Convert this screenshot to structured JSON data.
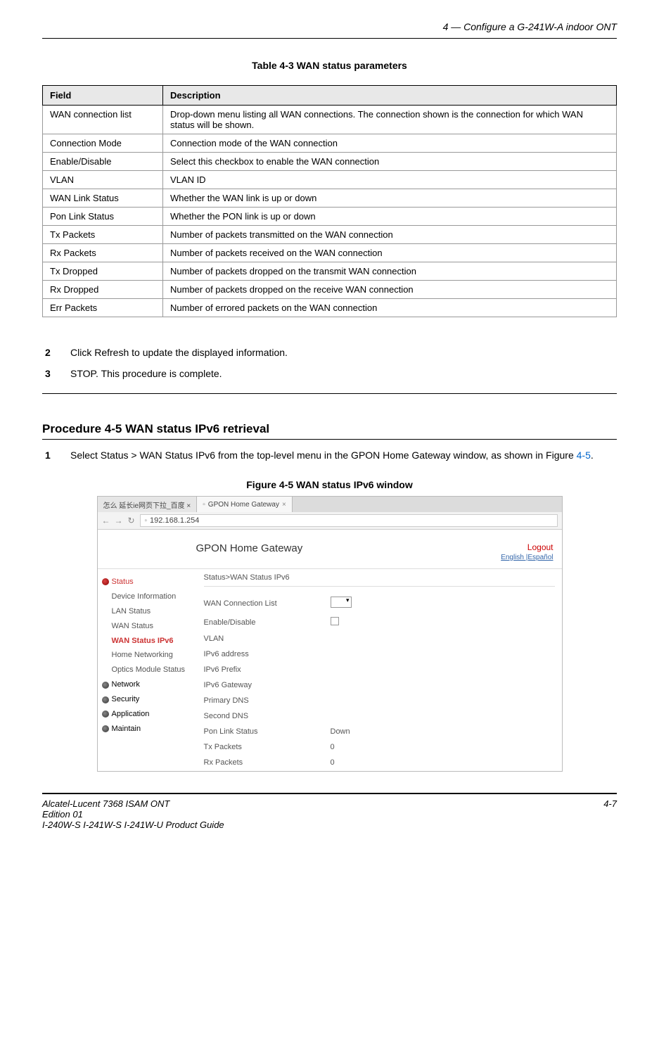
{
  "header": {
    "chapter_title": "4 —  Configure a G-241W-A indoor ONT"
  },
  "table_caption": "Table 4-3 WAN status parameters",
  "table": {
    "headers": [
      "Field",
      "Description"
    ],
    "rows": [
      {
        "field": "WAN connection list",
        "desc": "Drop-down menu listing all WAN connections. The connection shown is the connection for which WAN status will be shown."
      },
      {
        "field": "Connection Mode",
        "desc": "Connection mode of the WAN connection"
      },
      {
        "field": "Enable/Disable",
        "desc": "Select this checkbox to enable the WAN connection"
      },
      {
        "field": "VLAN",
        "desc": "VLAN ID"
      },
      {
        "field": "WAN Link Status",
        "desc": "Whether the WAN link is up or down"
      },
      {
        "field": "Pon Link Status",
        "desc": "Whether the PON link is up or down"
      },
      {
        "field": "Tx Packets",
        "desc": "Number of packets transmitted on the WAN connection"
      },
      {
        "field": "Rx Packets",
        "desc": "Number of packets received on the WAN connection"
      },
      {
        "field": "Tx Dropped",
        "desc": "Number of packets dropped on the transmit WAN connection"
      },
      {
        "field": "Rx Dropped",
        "desc": "Number of packets dropped on the receive WAN connection"
      },
      {
        "field": "Err Packets",
        "desc": "Number of errored packets on the WAN connection"
      }
    ]
  },
  "steps_a": [
    {
      "num": "2",
      "text": "Click Refresh to update the displayed information."
    },
    {
      "num": "3",
      "text": "STOP. This procedure is complete."
    }
  ],
  "procedure_title": "Procedure 4-5  WAN status IPv6 retrieval",
  "step_b": {
    "num": "1",
    "text_pre": "Select Status > WAN Status IPv6 from the top-level menu in the GPON Home Gateway window, as shown in Figure ",
    "fig_ref": "4-5",
    "text_post": "."
  },
  "figure_caption": "Figure 4-5  WAN status IPv6 window",
  "figure": {
    "tabs": [
      "怎么 延长ie网页下拉_百度 ×",
      "GPON Home Gateway"
    ],
    "url": "192.168.1.254",
    "gpon_header_title": "GPON Home Gateway",
    "logout": "Logout",
    "lang": "English |Español",
    "breadcrumb": "Status>WAN Status IPv6",
    "sidebar": {
      "status": "Status",
      "status_items": [
        "Device Information",
        "LAN Status",
        "WAN Status",
        "WAN Status IPv6",
        "Home Networking",
        "Optics Module Status"
      ],
      "network": "Network",
      "security": "Security",
      "application": "Application",
      "maintain": "Maintain"
    },
    "fields": [
      {
        "label": "WAN Connection List",
        "kind": "select",
        "value": ""
      },
      {
        "label": "Enable/Disable",
        "kind": "check",
        "value": ""
      },
      {
        "label": "VLAN",
        "kind": "text",
        "value": ""
      },
      {
        "label": "IPv6 address",
        "kind": "text",
        "value": ""
      },
      {
        "label": "IPv6 Prefix",
        "kind": "text",
        "value": ""
      },
      {
        "label": "IPv6 Gateway",
        "kind": "text",
        "value": ""
      },
      {
        "label": "Primary DNS",
        "kind": "text",
        "value": ""
      },
      {
        "label": "Second DNS",
        "kind": "text",
        "value": ""
      },
      {
        "label": "Pon Link Status",
        "kind": "text",
        "value": "Down"
      },
      {
        "label": "Tx Packets",
        "kind": "text",
        "value": "0"
      },
      {
        "label": "Rx Packets",
        "kind": "text",
        "value": "0"
      }
    ]
  },
  "footer": {
    "left_line1": "Alcatel-Lucent 7368 ISAM ONT",
    "left_line2": "Edition 01",
    "left_line3": "I-240W-S I-241W-S I-241W-U Product Guide",
    "right": "4-7"
  }
}
